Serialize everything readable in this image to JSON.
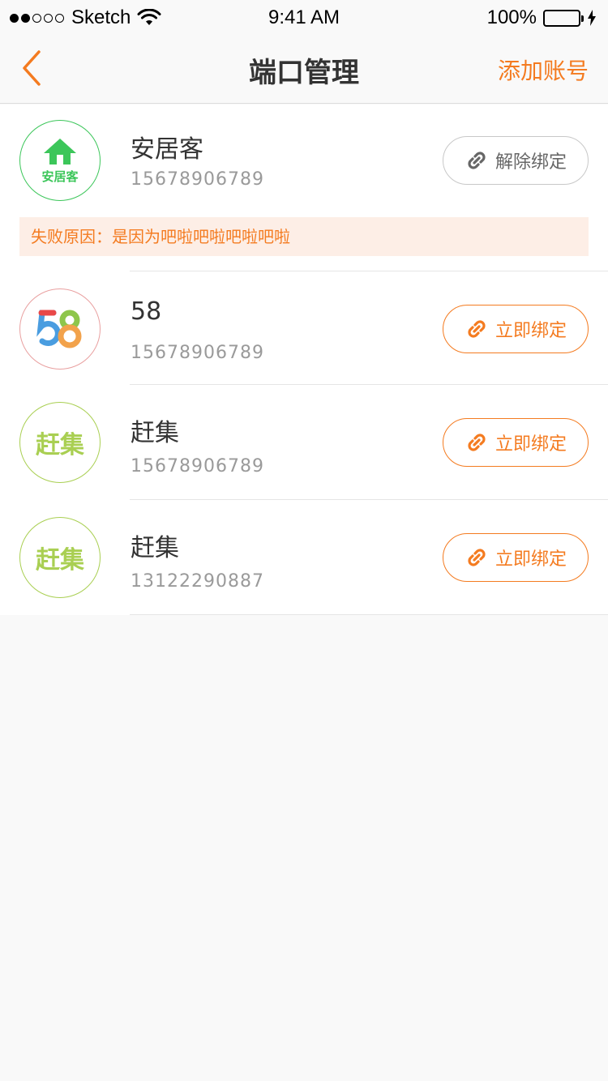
{
  "status_bar": {
    "carrier": "Sketch",
    "time": "9:41 AM",
    "battery": "100%"
  },
  "nav": {
    "title": "端口管理",
    "action": "添加账号"
  },
  "accounts": [
    {
      "name": "安居客",
      "phone": "15678906789",
      "logo": "anjuke-logo",
      "logo_text": "安居客",
      "button": "解除绑定",
      "fail_reason": "失败原因：是因为吧啦吧啦吧啦吧啦"
    },
    {
      "name": "58",
      "phone": "15678906789",
      "logo": "58-logo",
      "button": "立即绑定"
    },
    {
      "name": "赶集",
      "phone": "15678906789",
      "logo": "ganji-logo",
      "logo_text": "赶集",
      "button": "立即绑定"
    },
    {
      "name": "赶集",
      "phone": "13122290887",
      "logo": "ganji-logo",
      "logo_text": "赶集",
      "button": "立即绑定"
    }
  ],
  "colors": {
    "accent": "#f47b20",
    "anjuke_green": "#3cc65a",
    "ganji_green": "#a9cf52",
    "fail_bg": "#fdeee6"
  }
}
